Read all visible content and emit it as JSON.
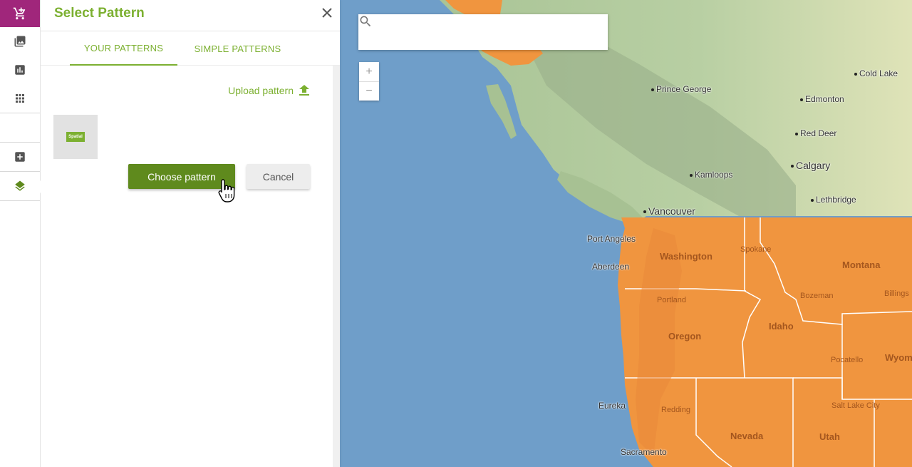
{
  "panel": {
    "title": "Select Pattern",
    "tabs": [
      {
        "label": "YOUR PATTERNS",
        "active": true
      },
      {
        "label": "SIMPLE PATTERNS",
        "active": false
      }
    ],
    "upload_label": "Upload pattern",
    "thumbnail_text": "Spatial",
    "choose_button": "Choose pattern",
    "cancel_button": "Cancel"
  },
  "rail": {
    "icons": [
      "cart-icon",
      "image-icon",
      "chart-icon",
      "grid-icon",
      "add-icon",
      "layers-icon"
    ],
    "accent": "#a0267b"
  },
  "map": {
    "search_placeholder": "",
    "zoom_in": "+",
    "zoom_out": "−",
    "cities": {
      "prince_george": "Prince George",
      "cold_lake": "Cold Lake",
      "edmonton": "Edmonton",
      "red_deer": "Red Deer",
      "calgary": "Calgary",
      "kamloops": "Kamloops",
      "lethbridge": "Lethbridge",
      "vancouver": "Vancouver",
      "port_angeles": "Port Angeles",
      "aberdeen": "Aberdeen",
      "spokane": "Spokane",
      "portland": "Portland",
      "bozeman": "Bozeman",
      "billings": "Billings",
      "pocatello": "Pocatello",
      "eureka": "Eureka",
      "redding": "Redding",
      "salt_lake_city": "Salt Lake City",
      "sacramento": "Sacramento"
    },
    "states": {
      "washington": "Washington",
      "montana": "Montana",
      "oregon": "Oregon",
      "idaho": "Idaho",
      "wyoming": "Wyomin",
      "nevada": "Nevada",
      "utah": "Utah"
    }
  },
  "colors": {
    "brand_green": "#7cb031",
    "button_green": "#5f8a1d",
    "highlight_orange": "#f0953f",
    "ocean": "#6f9ec9"
  }
}
